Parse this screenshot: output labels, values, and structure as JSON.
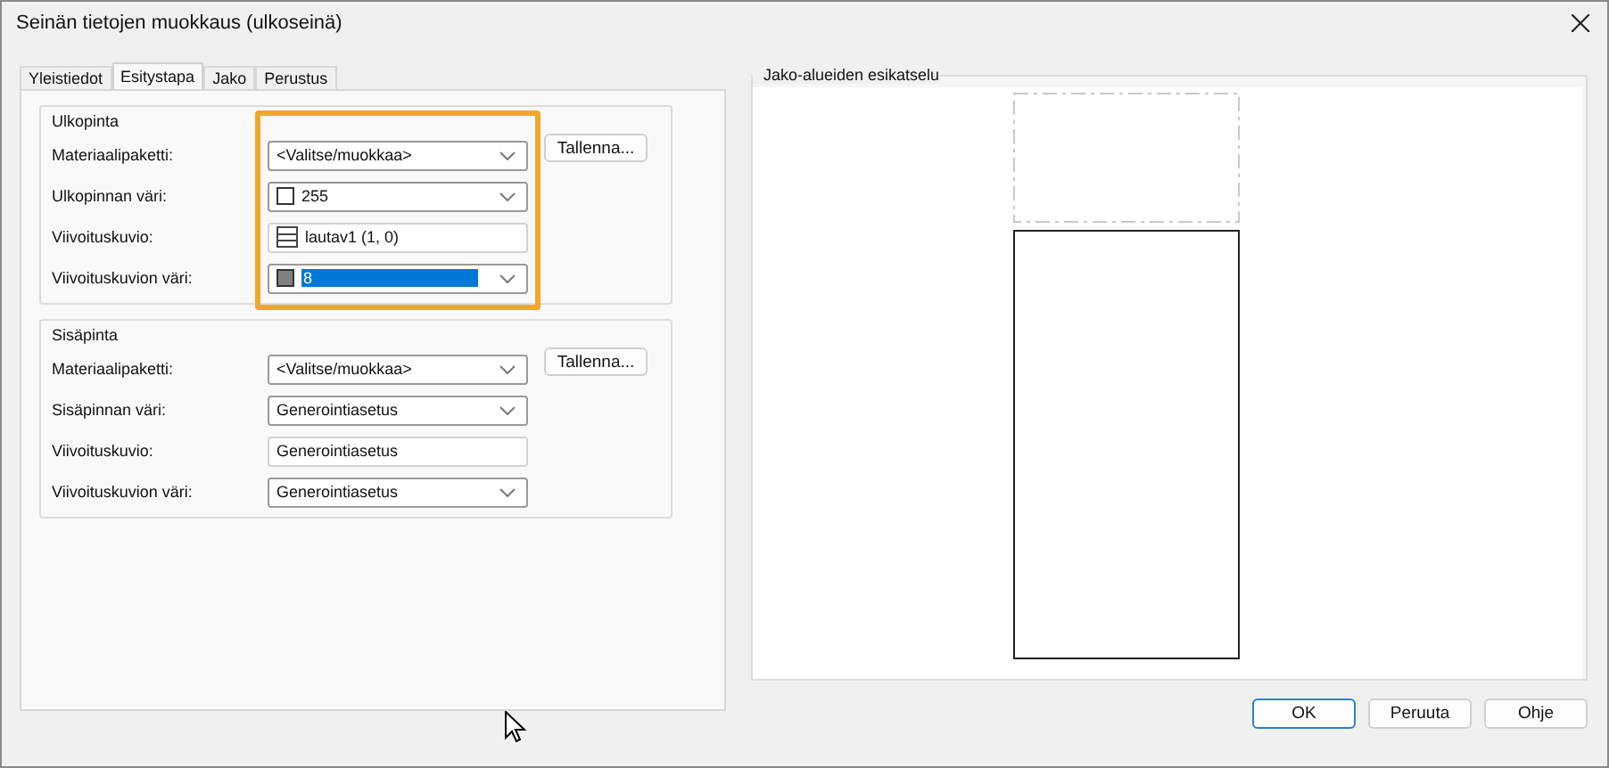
{
  "window": {
    "title": "Seinän tietojen muokkaus (ulkoseinä)"
  },
  "tabs": [
    {
      "label": "Yleistiedot",
      "selected": false
    },
    {
      "label": "Esitystapa",
      "selected": true
    },
    {
      "label": "Jako",
      "selected": false
    },
    {
      "label": "Perustus",
      "selected": false
    }
  ],
  "groups": [
    {
      "title": "Ulkopinta",
      "highlighted": true,
      "rows": [
        {
          "label": "Materiaalipaketti:",
          "kind": "combo",
          "value": "<Valitse/muokkaa>",
          "button": "Tallenna..."
        },
        {
          "label": "Ulkopinnan väri:",
          "kind": "combo",
          "swatch": {
            "kind": "color",
            "color": "#ffffff"
          },
          "value": "255"
        },
        {
          "label": "Viivoituskuvio:",
          "kind": "text",
          "swatch": {
            "kind": "hatch"
          },
          "value": "lautav1 (1, 0)"
        },
        {
          "label": "Viivoituskuvion väri:",
          "kind": "combo",
          "swatch": {
            "kind": "color",
            "color": "#808080"
          },
          "value": "8",
          "selected": true
        }
      ]
    },
    {
      "title": "Sisäpinta",
      "highlighted": false,
      "rows": [
        {
          "label": "Materiaalipaketti:",
          "kind": "combo",
          "value": "<Valitse/muokkaa>",
          "button": "Tallenna..."
        },
        {
          "label": "Sisäpinnan väri:",
          "kind": "combo",
          "value": "Generointiasetus"
        },
        {
          "label": "Viivoituskuvio:",
          "kind": "text",
          "value": "Generointiasetus"
        },
        {
          "label": "Viivoituskuvion väri:",
          "kind": "combo",
          "value": "Generointiasetus"
        }
      ]
    }
  ],
  "preview": {
    "title": "Jako-alueiden esikatselu"
  },
  "buttons": [
    {
      "label": "OK",
      "default": true
    },
    {
      "label": "Peruuta",
      "default": false
    },
    {
      "label": "Ohje",
      "default": false
    }
  ]
}
